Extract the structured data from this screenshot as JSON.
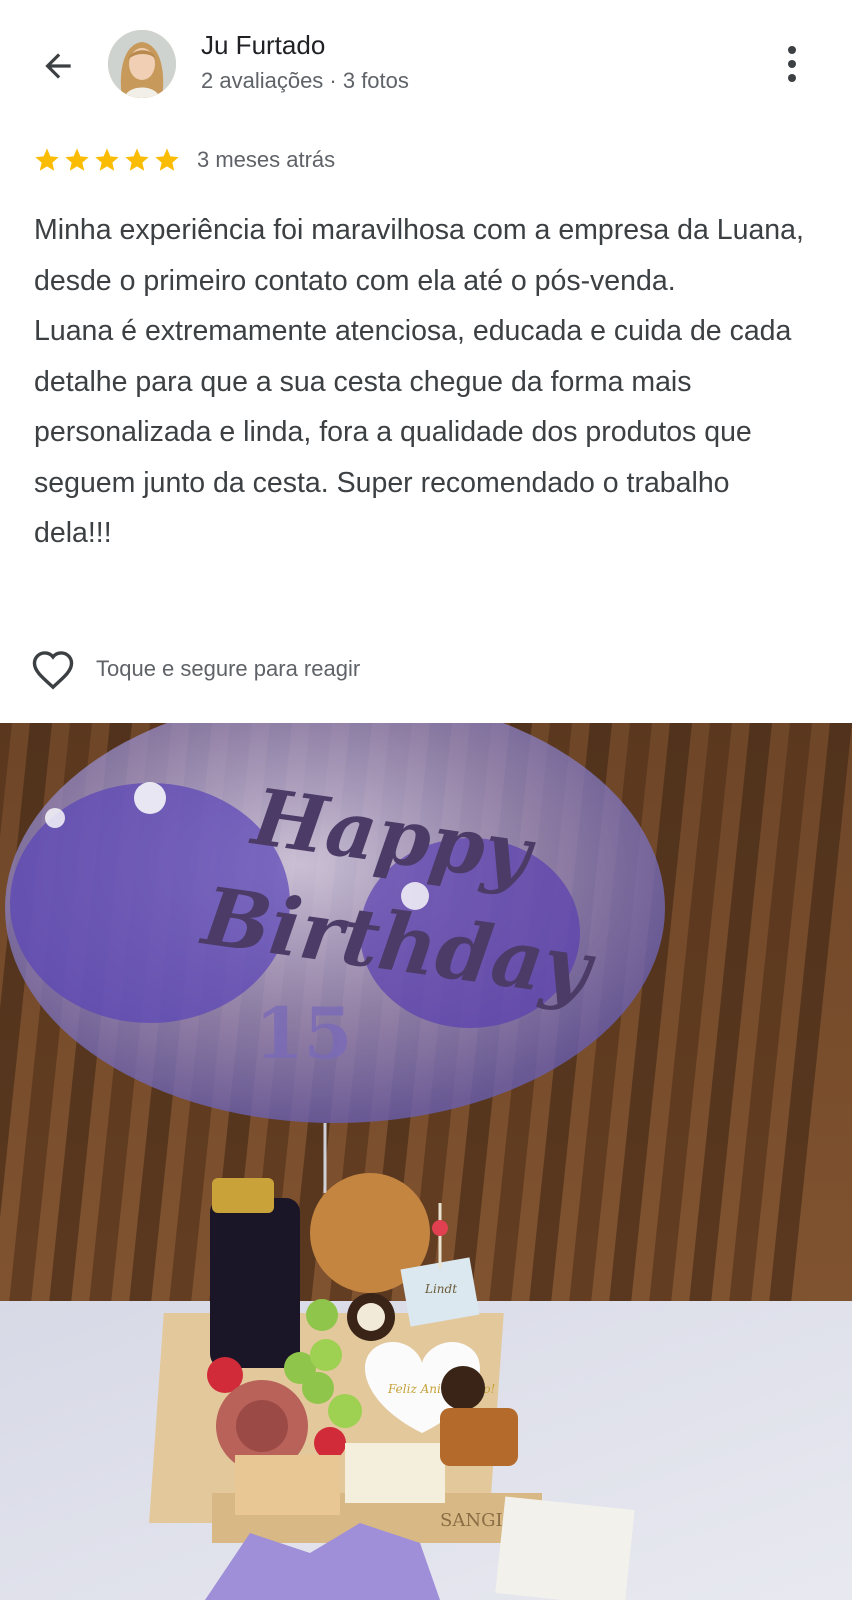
{
  "header": {
    "back_icon": "arrow-left-icon",
    "reviewer_name": "Ju Furtado",
    "reviewer_meta": "2 avaliações · 3 fotos",
    "more_icon": "more-vert-icon"
  },
  "review": {
    "rating": 5,
    "rating_max": 5,
    "star_color": "#fbbc04",
    "time_ago": "3 meses atrás",
    "text": "Minha experiência foi maravilhosa com a empresa da Luana, desde o primeiro contato com ela até o pós-venda.\nLuana é extremamente atenciosa, educada e cuida de cada detalhe para que a sua cesta chegue da forma mais personalizada e linda, fora a qualidade dos produtos que seguem junto da cesta. Super recomendado o trabalho dela!!!"
  },
  "reaction": {
    "icon": "heart-outline-icon",
    "label": "Toque e segure para reagir"
  },
  "photo": {
    "balloon_top": "Happy",
    "balloon_bottom": "Birthday",
    "balloon_number": "15",
    "card_text": "Feliz Aniversário!",
    "box_brand": "SANGI",
    "chocolate_brand": "Lindt"
  }
}
